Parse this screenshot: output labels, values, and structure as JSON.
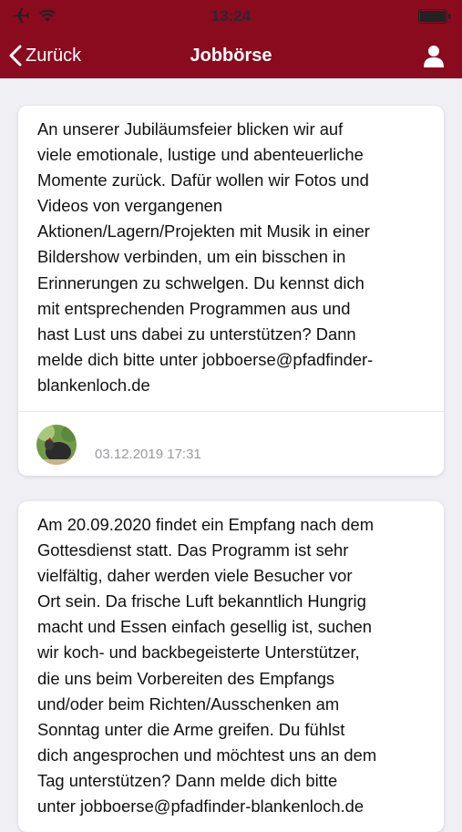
{
  "status_bar": {
    "time": "13:24"
  },
  "nav": {
    "back_label": "Zurück",
    "title": "Jobbörse"
  },
  "posts": [
    {
      "text": "An unserer Jubiläumsfeier blicken wir auf\nviele emotionale, lustige und abenteuerliche\nMomente zurück. Dafür wollen wir Fotos und\nVideos von vergangenen\nAktionen/Lagern/Projekten mit Musik in einer\nBildershow verbinden, um ein bisschen in\nErinnerungen zu schwelgen. Du kennst dich\nmit entsprechenden Programmen aus und\nhast Lust uns dabei zu unterstützen? Dann\nmelde dich bitte unter jobboerse@pfadfinder-\nblankenloch.de",
      "date": "03.12.2019 17:31"
    },
    {
      "text": "Am 20.09.2020 findet ein Empfang nach dem\nGottesdienst statt. Das Programm ist sehr\nvielfältig, daher werden viele Besucher vor\nOrt sein. Da frische Luft bekanntlich Hungrig\nmacht und Essen einfach gesellig ist, suchen\nwir koch- und backbegeisterte Unterstützer,\ndie uns beim Vorbereiten des Empfangs\nund/oder beim Richten/Ausschenken am\nSonntag unter die Arme greifen. Du fühlst\ndich angesprochen und möchtest uns an dem\nTag unterstützen? Dann melde dich bitte\nunter jobboerse@pfadfinder-blankenloch.de"
    }
  ],
  "colors": {
    "brand": "#8a0a1e",
    "background": "#efeff4"
  }
}
